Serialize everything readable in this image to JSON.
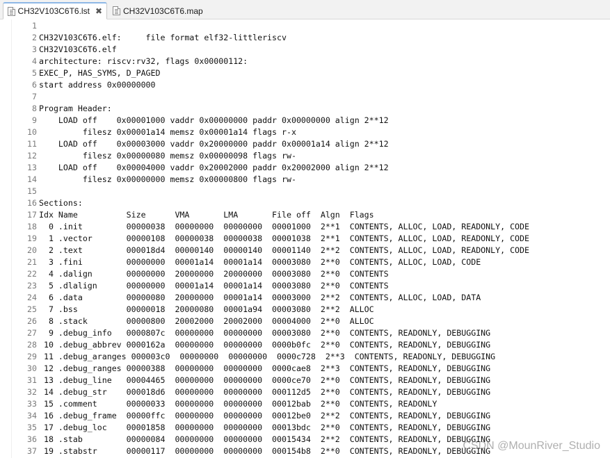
{
  "tabs": [
    {
      "label": "CH32V103C6T6.lst",
      "active": true,
      "close": "✖"
    },
    {
      "label": "CH32V103C6T6.map",
      "active": false
    }
  ],
  "lines": [
    {
      "n": "1",
      "t": ""
    },
    {
      "n": "2",
      "t": "CH32V103C6T6.elf:     file format elf32-littleriscv"
    },
    {
      "n": "3",
      "t": "CH32V103C6T6.elf"
    },
    {
      "n": "4",
      "t": "architecture: riscv:rv32, flags 0x00000112:"
    },
    {
      "n": "5",
      "t": "EXEC_P, HAS_SYMS, D_PAGED"
    },
    {
      "n": "6",
      "t": "start address 0x00000000"
    },
    {
      "n": "7",
      "t": ""
    },
    {
      "n": "8",
      "t": "Program Header:"
    },
    {
      "n": "9",
      "t": "    LOAD off    0x00001000 vaddr 0x00000000 paddr 0x00000000 align 2**12"
    },
    {
      "n": "10",
      "t": "         filesz 0x00001a14 memsz 0x00001a14 flags r-x"
    },
    {
      "n": "11",
      "t": "    LOAD off    0x00003000 vaddr 0x20000000 paddr 0x00001a14 align 2**12"
    },
    {
      "n": "12",
      "t": "         filesz 0x00000080 memsz 0x00000098 flags rw-"
    },
    {
      "n": "13",
      "t": "    LOAD off    0x00004000 vaddr 0x20002000 paddr 0x20002000 align 2**12"
    },
    {
      "n": "14",
      "t": "         filesz 0x00000000 memsz 0x00000800 flags rw-"
    },
    {
      "n": "15",
      "t": ""
    },
    {
      "n": "16",
      "t": "Sections:"
    },
    {
      "n": "17",
      "t": "Idx Name          Size      VMA       LMA       File off  Algn  Flags"
    },
    {
      "n": "18",
      "t": "  0 .init         00000038  00000000  00000000  00001000  2**1  CONTENTS, ALLOC, LOAD, READONLY, CODE"
    },
    {
      "n": "19",
      "t": "  1 .vector       00000108  00000038  00000038  00001038  2**1  CONTENTS, ALLOC, LOAD, READONLY, CODE"
    },
    {
      "n": "20",
      "t": "  2 .text         000018d4  00000140  00000140  00001140  2**2  CONTENTS, ALLOC, LOAD, READONLY, CODE"
    },
    {
      "n": "21",
      "t": "  3 .fini         00000000  00001a14  00001a14  00003080  2**0  CONTENTS, ALLOC, LOAD, CODE"
    },
    {
      "n": "22",
      "t": "  4 .dalign       00000000  20000000  20000000  00003080  2**0  CONTENTS"
    },
    {
      "n": "23",
      "t": "  5 .dlalign      00000000  00001a14  00001a14  00003080  2**0  CONTENTS"
    },
    {
      "n": "24",
      "t": "  6 .data         00000080  20000000  00001a14  00003000  2**2  CONTENTS, ALLOC, LOAD, DATA"
    },
    {
      "n": "25",
      "t": "  7 .bss          00000018  20000080  00001a94  00003080  2**2  ALLOC"
    },
    {
      "n": "26",
      "t": "  8 .stack        00000800  20002000  20002000  00004000  2**0  ALLOC"
    },
    {
      "n": "27",
      "t": "  9 .debug_info   0000807c  00000000  00000000  00003080  2**0  CONTENTS, READONLY, DEBUGGING"
    },
    {
      "n": "28",
      "t": " 10 .debug_abbrev 0000162a  00000000  00000000  0000b0fc  2**0  CONTENTS, READONLY, DEBUGGING"
    },
    {
      "n": "29",
      "t": " 11 .debug_aranges 000003c0  00000000  00000000  0000c728  2**3  CONTENTS, READONLY, DEBUGGING"
    },
    {
      "n": "30",
      "t": " 12 .debug_ranges 00000388  00000000  00000000  0000cae8  2**3  CONTENTS, READONLY, DEBUGGING"
    },
    {
      "n": "31",
      "t": " 13 .debug_line   00004465  00000000  00000000  0000ce70  2**0  CONTENTS, READONLY, DEBUGGING"
    },
    {
      "n": "32",
      "t": " 14 .debug_str    000018d6  00000000  00000000  000112d5  2**0  CONTENTS, READONLY, DEBUGGING"
    },
    {
      "n": "33",
      "t": " 15 .comment      00000033  00000000  00000000  00012bab  2**0  CONTENTS, READONLY"
    },
    {
      "n": "34",
      "t": " 16 .debug_frame  00000ffc  00000000  00000000  00012be0  2**2  CONTENTS, READONLY, DEBUGGING"
    },
    {
      "n": "35",
      "t": " 17 .debug_loc    00001858  00000000  00000000  00013bdc  2**0  CONTENTS, READONLY, DEBUGGING"
    },
    {
      "n": "36",
      "t": " 18 .stab         00000084  00000000  00000000  00015434  2**2  CONTENTS, READONLY, DEBUGGING"
    },
    {
      "n": "37",
      "t": " 19 .stabstr      00000117  00000000  00000000  000154b8  2**0  CONTENTS, READONLY, DEBUGGING"
    }
  ],
  "watermark": "CSDN @MounRiver_Studio",
  "colors": {
    "tab_accent": "#8eb8e6",
    "line_number": "#7a7a7a",
    "text": "#111111"
  }
}
